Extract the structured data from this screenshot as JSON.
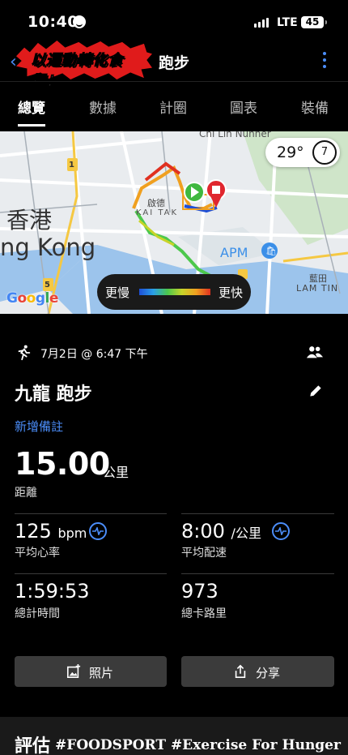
{
  "status_bar": {
    "time": "10:40",
    "network": "LTE",
    "battery": "45"
  },
  "header": {
    "banner_text": "以運動轉化食糧！",
    "title": "跑步",
    "back_icon": "chevron-left-icon",
    "menu_icon": "more-vertical-icon"
  },
  "tabs": [
    {
      "label": "總覽",
      "active": true
    },
    {
      "label": "數據",
      "active": false
    },
    {
      "label": "計圈",
      "active": false
    },
    {
      "label": "圖表",
      "active": false
    },
    {
      "label": "裝備",
      "active": false
    }
  ],
  "map": {
    "labels": {
      "hong_kong_zh": "香港",
      "hong_kong_en": "ng Kong",
      "kai_tak_zh": "啟德",
      "kai_tak_en": "KAI TAK",
      "apm": "APM",
      "lam_tin_zh": "藍田",
      "lam_tin_en": "LAM TIN",
      "chi_lin": "Chi Lin Nunner",
      "road_1": "1",
      "road_5": "5",
      "google": "Google"
    },
    "weather": {
      "temperature": "29°",
      "wind": "7"
    },
    "pace_legend": {
      "slow": "更慢",
      "fast": "更快"
    },
    "colors": {
      "route_slow": "#1e4fd6",
      "route_fast": "#e03020",
      "start": "#3fb83f",
      "end": "#e0262e"
    }
  },
  "activity": {
    "date": "7月2日 @ 6:47 下午",
    "title": "九龍 跑步",
    "add_note": "新增備註",
    "distance": {
      "value": "15.00",
      "unit": "公里",
      "label": "距離"
    },
    "stats": {
      "heart_rate": {
        "value": "125",
        "unit": "bpm",
        "label": "平均心率"
      },
      "pace": {
        "value": "8:00",
        "unit": "/公里",
        "label": "平均配速"
      },
      "time": {
        "value": "1:59:53",
        "label": "總計時間"
      },
      "calories": {
        "value": "973",
        "label": "總卡路里"
      }
    }
  },
  "buttons": {
    "photos": "照片",
    "share": "分享"
  },
  "evaluation": {
    "heading": "評估",
    "watermark": "#FOODSPORT #Exercise For Hunger"
  }
}
